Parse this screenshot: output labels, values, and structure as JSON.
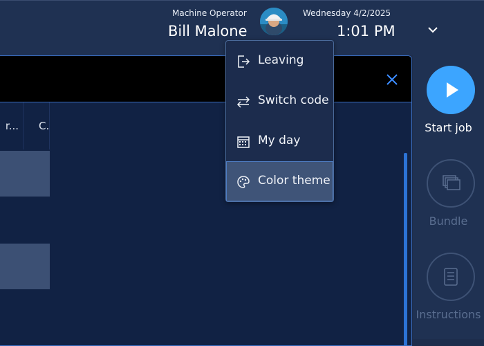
{
  "header": {
    "role": "Machine Operator",
    "user_name": "Bill Malone",
    "date": "Wednesday 4/2/2025",
    "time": "1:01 PM"
  },
  "table": {
    "columns": [
      "r...",
      "C."
    ]
  },
  "menu": {
    "items": [
      {
        "label": "Leaving",
        "icon": "sign-out-icon"
      },
      {
        "label": "Switch code",
        "icon": "swap-arrows-icon"
      },
      {
        "label": "My day",
        "icon": "calendar-icon"
      },
      {
        "label": "Color theme",
        "icon": "palette-icon",
        "active": true
      }
    ]
  },
  "sidebar": {
    "start_job": "Start job",
    "bundle": "Bundle",
    "instructions": "Instructions"
  },
  "colors": {
    "accent": "#3ca5ff",
    "background": "#1d2d4c",
    "panel": "#112244"
  }
}
